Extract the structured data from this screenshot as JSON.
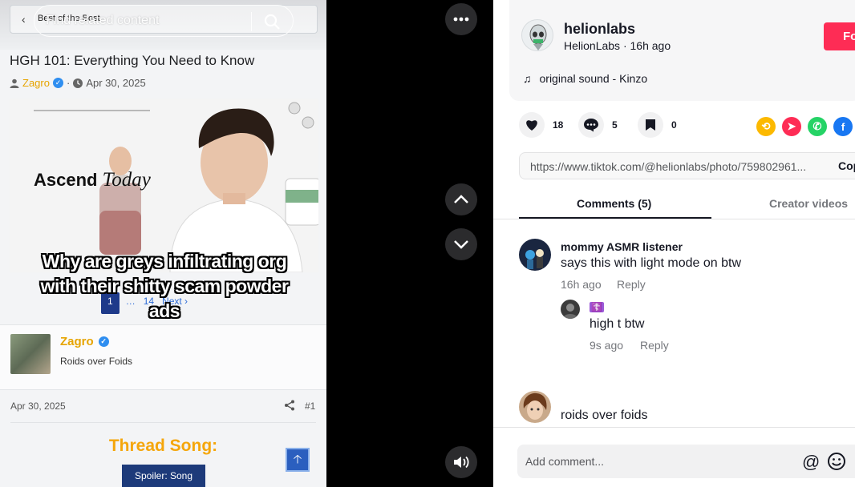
{
  "photo": {
    "breadcrumb": "Best of the Best",
    "find_placeholder": "Find related content",
    "thread_title": "HGH 101: Everything You Need to Know",
    "author": "Zagro",
    "date": "Apr 30, 2025",
    "ad_brand_bold": "Ascend",
    "ad_brand_italic": "Today",
    "caption": "Why are greys infiltrating org with their shitty scam powder ads",
    "pager": {
      "page": "1",
      "ellipsis": "…",
      "last": "14",
      "next": "Next ›"
    },
    "post_author": "Zagro",
    "post_subtitle": "Roids over Foids",
    "post_date": "Apr 30, 2025",
    "post_number": "#1",
    "thread_song": "Thread Song:",
    "spoiler": "Spoiler: Song"
  },
  "controls": {
    "more_icon": "more-horizontal-icon",
    "up_icon": "chevron-up-icon",
    "down_icon": "chevron-down-icon",
    "volume_icon": "volume-icon"
  },
  "post": {
    "username": "helionlabs",
    "display_name": "HelionLabs",
    "age": "16h ago",
    "follow_label": "Fo",
    "sound": "original sound - Kinzo",
    "likes": "18",
    "comments": "5",
    "saves": "0",
    "link": "https://www.tiktok.com/@helionlabs/photo/759802961...",
    "copy_label": "Cop"
  },
  "tabs": [
    {
      "label": "Comments (5)",
      "active": true
    },
    {
      "label": "Creator videos",
      "active": false
    }
  ],
  "comments": [
    {
      "name": "mommy ASMR listener",
      "text": "says this with light mode on btw",
      "time": "16h ago",
      "reply": "Reply"
    },
    {
      "name": "☦️",
      "text": "high t btw",
      "time": "9s ago",
      "reply": "Reply"
    },
    {
      "name": "",
      "text": "roids over foids"
    }
  ],
  "composer": {
    "placeholder": "Add comment..."
  },
  "colors": {
    "accent": "#fe2c55",
    "forum_gold": "#e6a400",
    "forum_blue": "#1d3a7a"
  }
}
